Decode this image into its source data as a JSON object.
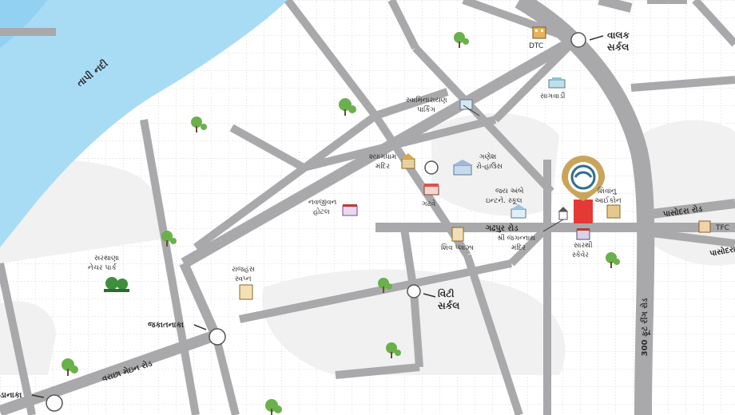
{
  "colors": {
    "river": "#a8dcf5",
    "river_edge": "#7cc6ee",
    "road": "#a9a9ab",
    "road_light": "#c9c9cb",
    "grid": "#d8d8d8",
    "blob": "#f0f0f1",
    "marker": "#c8a55a",
    "site": "#e53935"
  },
  "river": {
    "name": "તાપી નદી"
  },
  "circles": {
    "valak": {
      "l1": "વાલક",
      "l2": "સર્કલ"
    },
    "vitthi": {
      "l1": "વિટી",
      "l2": "સર્કલ"
    },
    "jakatnaka": {
      "l1": "જકાતનાકા"
    },
    "danaka": {
      "l1": "ડાનાકા"
    }
  },
  "roads": {
    "gadhpur": "ગઢપુર રોડ",
    "varachha": "વરાછા મેઇન રોડ",
    "ring": "300 ફૂટ રીંગ રોડ",
    "pasodara": "પાસોદરા રોડ",
    "pasodara2": "પાસોદરા"
  },
  "places": {
    "dtc": "DTC",
    "sagwadi": "સાગવાડી",
    "swaminarayan_l1": "સ્વામિનારાયણ",
    "swaminarayan_l2": "પાર્કિંગ",
    "shyamdham_l1": "શ્યામધામ",
    "shyamdham_l2": "મંદિર",
    "ganesh_l1": "ગણેશ",
    "ganesh_l2": "રો-હાઉસ",
    "navjivan_l1": "નવજીવન",
    "navjivan_l2": "હોટલ",
    "gatve": "ગટવે",
    "jay_ambe_l1": "જય અંબે",
    "jay_ambe_l2": "ઇન્ટને. સ્કૂલ",
    "shivanu_l1": "શિવાંનુ",
    "shivanu_l2": "આઈકોન",
    "shiv_plaza": "શિવ પ્લાઝા",
    "jagannath_l1": "શ્રી જગન્નાથ",
    "jagannath_l2": "મંદિર",
    "sarthi_l1": "સારથી",
    "sarthi_l2": "સ્કેવેર",
    "sarthana_l1": "સરથાણા",
    "sarthana_l2": "નેચર પાર્ક",
    "rajhans_l1": "રાજહંસ",
    "rajhans_l2": "સ્વપ્ન",
    "tfc": "TFC"
  }
}
